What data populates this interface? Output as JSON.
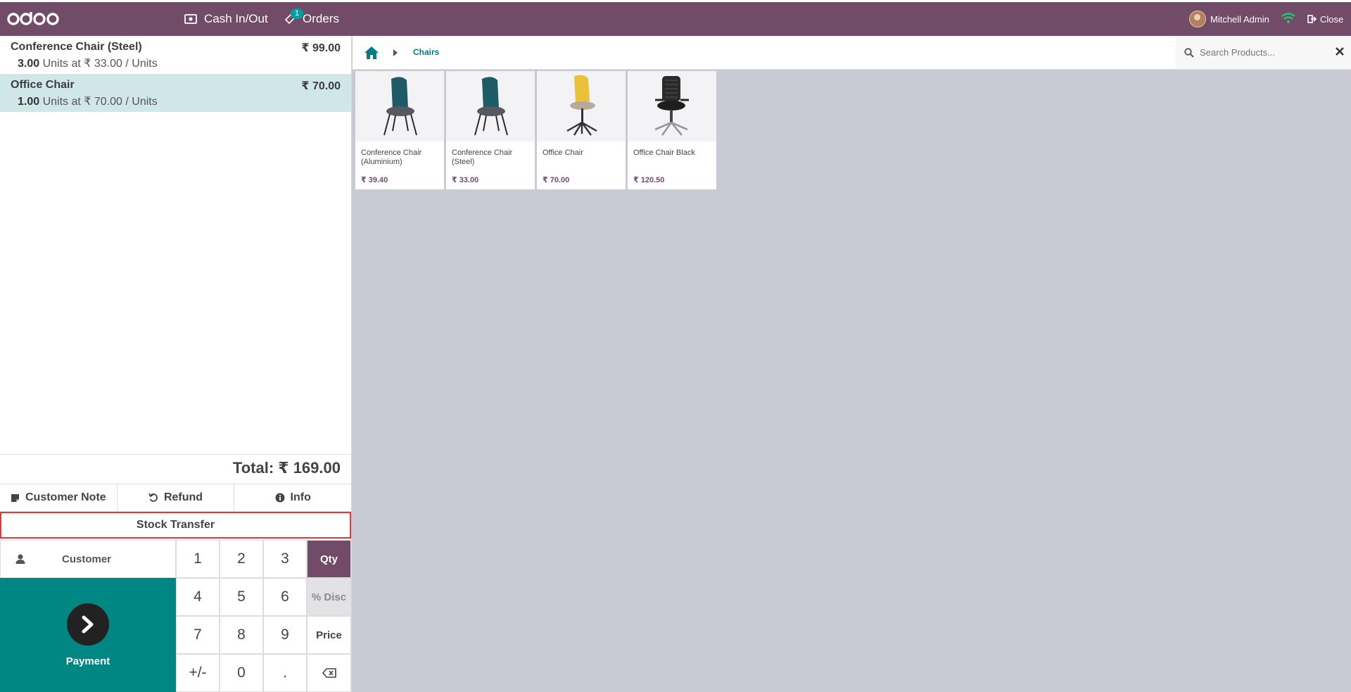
{
  "topbar": {
    "logo_text": "odoo",
    "cash_label": "Cash In/Out",
    "orders_label": "Orders",
    "orders_badge": "1",
    "user_name": "Mitchell Admin",
    "close_label": "Close"
  },
  "order": {
    "lines": [
      {
        "name": "Conference Chair (Steel)",
        "price": "₹ 99.00",
        "qty": "3.00",
        "detail": " Units at ₹ 33.00 / Units"
      },
      {
        "name": "Office Chair",
        "price": "₹ 70.00",
        "qty": "1.00",
        "detail": " Units at ₹ 70.00 / Units"
      }
    ],
    "total": "Total: ₹ 169.00"
  },
  "controls": {
    "customer_note": "Customer Note",
    "refund": "Refund",
    "info": "Info",
    "stock_transfer": "Stock Transfer"
  },
  "pad": {
    "customer": "Customer",
    "payment": "Payment",
    "keys": [
      "1",
      "2",
      "3",
      "Qty",
      "4",
      "5",
      "6",
      "% Disc",
      "7",
      "8",
      "9",
      "Price",
      "+/-",
      "0",
      "."
    ]
  },
  "products_header": {
    "breadcrumb": "Chairs",
    "search_placeholder": "Search Products..."
  },
  "products": [
    {
      "name": "Conference Chair (Aluminium)",
      "price": "₹ 39.40"
    },
    {
      "name": "Conference Chair (Steel)",
      "price": "₹ 33.00"
    },
    {
      "name": "Office Chair",
      "price": "₹ 70.00"
    },
    {
      "name": "Office Chair Black",
      "price": "₹ 120.50"
    }
  ],
  "colors": {
    "brand": "#714b67",
    "teal": "#008784",
    "selected_line": "#cfe7e8",
    "highlight_border": "#e53935"
  }
}
